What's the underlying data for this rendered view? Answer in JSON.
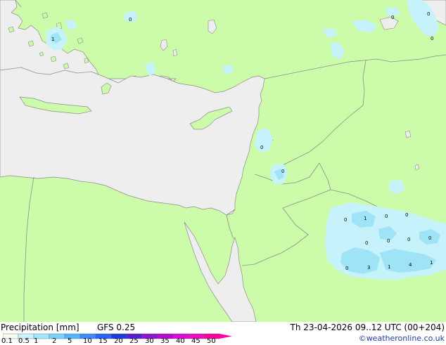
{
  "footer": {
    "title": "Precipitation [mm]",
    "model": "GFS 0.25",
    "run": "Th 23-04-2026 09..12 UTC (00+204)",
    "credit": "©weatheronline.co.uk"
  },
  "scale": {
    "ticks": [
      "0.1",
      "0.5",
      "1",
      "2",
      "5",
      "10",
      "15",
      "20",
      "25",
      "30",
      "35",
      "40",
      "45",
      "50"
    ],
    "colors": [
      "#f5fff0",
      "#c8f5ff",
      "#a0e6ff",
      "#78d2ff",
      "#50b4ff",
      "#3c8cff",
      "#2864ff",
      "#1e3cdc",
      "#5a1ed2",
      "#8c14d2",
      "#b40ad2",
      "#dc0adc",
      "#f00ac8",
      "#ff00a0"
    ]
  },
  "colors": {
    "land": "#ccfcaa",
    "sea": "#eeeeee",
    "rain_light": "#c6f2fb",
    "rain_moderate": "#9fe3f6",
    "border": "#8c8c8c"
  },
  "map_labels": [
    "1",
    "0",
    "0",
    "0",
    "0",
    "0",
    "0",
    "1",
    "0",
    "0",
    "0",
    "0",
    "0",
    "0",
    "0",
    "0",
    "3",
    "1",
    "4",
    "1"
  ]
}
